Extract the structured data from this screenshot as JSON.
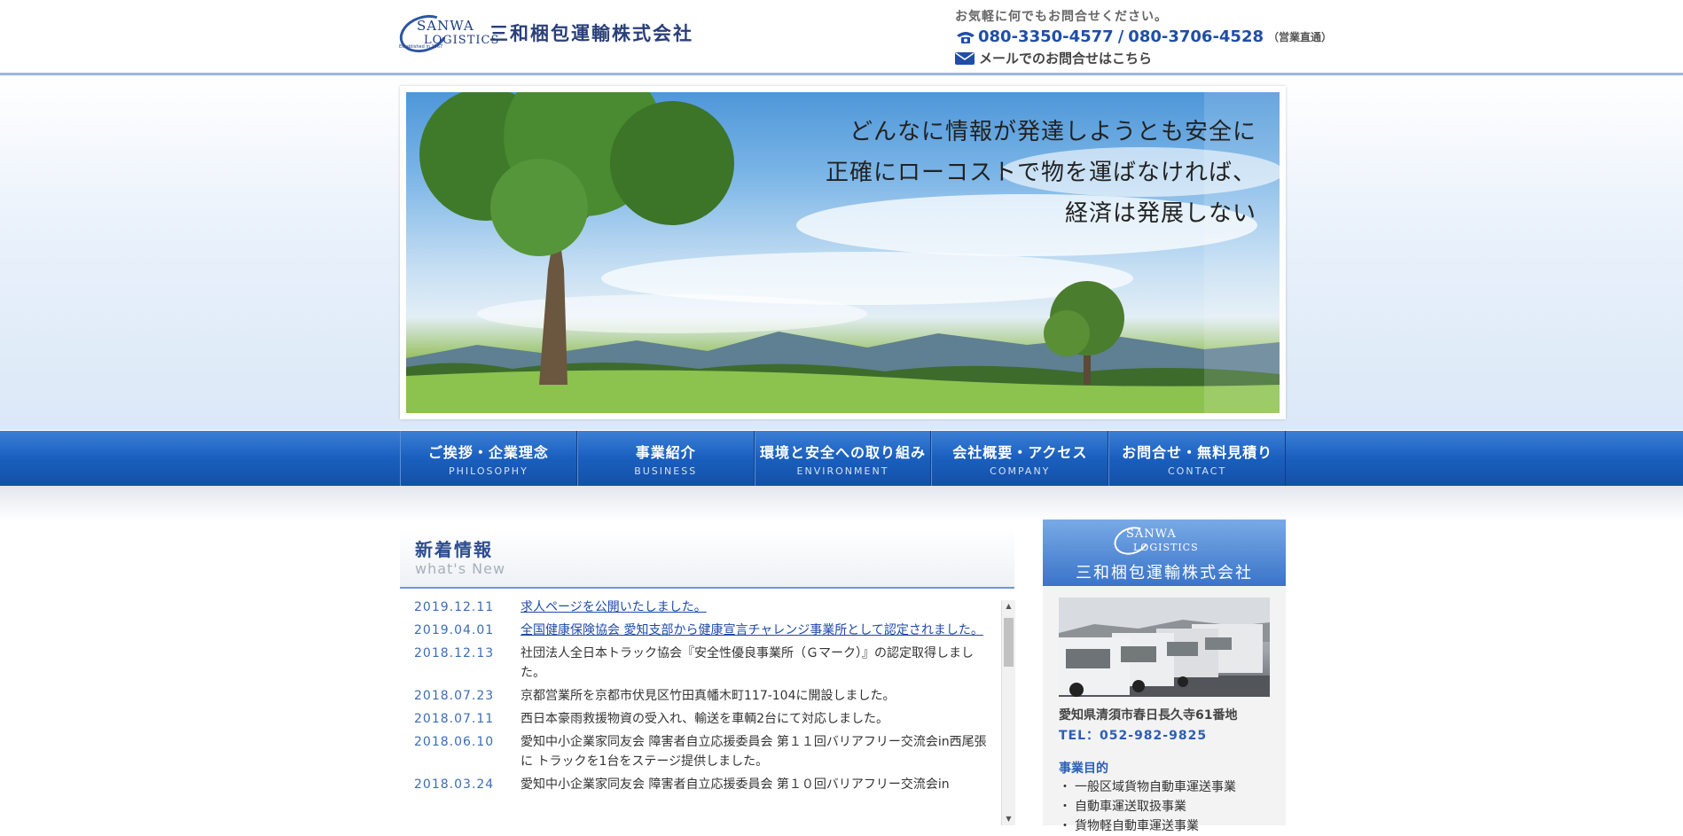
{
  "header": {
    "logo": {
      "mark_word1": "SANWA",
      "mark_word2": "LOGISTICS",
      "mark_small": "Established in 1967",
      "company_name": "三和梱包運輸株式会社"
    },
    "contact": {
      "lead": "お気軽に何でもお問合せください。",
      "phone1": "080-3350-4577",
      "separator": "/",
      "phone2": "080-3706-4528",
      "phone_note": "（営業直通）",
      "mail_text": "メールでのお問合せはこちら"
    }
  },
  "hero": {
    "lines": [
      "どんなに情報が発達しようとも安全に",
      "正確にローコストで物を運ばなければ、",
      "経済は発展しない"
    ]
  },
  "nav": [
    {
      "jp": "ご挨拶・企業理念",
      "en": "PHILOSOPHY"
    },
    {
      "jp": "事業紹介",
      "en": "BUSINESS"
    },
    {
      "jp": "環境と安全への取り組み",
      "en": "ENVIRONMENT"
    },
    {
      "jp": "会社概要・アクセス",
      "en": "COMPANY"
    },
    {
      "jp": "お問合せ・無料見積り",
      "en": "CONTACT"
    }
  ],
  "news": {
    "title": "新着情報",
    "subtitle": "what's New",
    "items": [
      {
        "date": "2019.12.11",
        "text": "求人ページを公開いたしました。",
        "link": true
      },
      {
        "date": "2019.04.01",
        "text": "全国健康保険協会 愛知支部から健康宣言チャレンジ事業所として認定されました。",
        "link": true
      },
      {
        "date": "2018.12.13",
        "text": "社団法人全日本トラック協会『安全性優良事業所（Ｇマーク）』の認定取得しました。",
        "link": false
      },
      {
        "date": "2018.07.23",
        "text": "京都営業所を京都市伏見区竹田真幡木町117-104に開設しました。",
        "link": false
      },
      {
        "date": "2018.07.11",
        "text": "西日本豪雨救援物資の受入れ、輸送を車輌2台にて対応しました。",
        "link": false
      },
      {
        "date": "2018.06.10",
        "text": "愛知中小企業家同友会 障害者自立応援委員会 第１１回バリアフリー交流会in西尾張に トラックを1台をステージ提供しました。",
        "link": false
      },
      {
        "date": "2018.03.24",
        "text": "愛知中小企業家同友会 障害者自立応援委員会 第１０回バリアフリー交流会in",
        "link": false
      }
    ]
  },
  "sidebar": {
    "logo_word1": "SANWA",
    "logo_word2": "LOGISTICS",
    "company_name": "三和梱包運輸株式会社",
    "address": "愛知県清須市春日長久寺61番地",
    "tel": "TEL：052-982-9825",
    "purpose_title": "事業目的",
    "purpose_items": [
      "一般区域貨物自動車運送事業",
      "自動車運送取扱事業",
      "貨物軽自動車運送事業"
    ]
  },
  "colors": {
    "brand_blue": "#1f4ea8",
    "nav_blue": "#1a5fbe",
    "link_blue": "#1e4aa8",
    "date_blue": "#3d6cb3"
  }
}
